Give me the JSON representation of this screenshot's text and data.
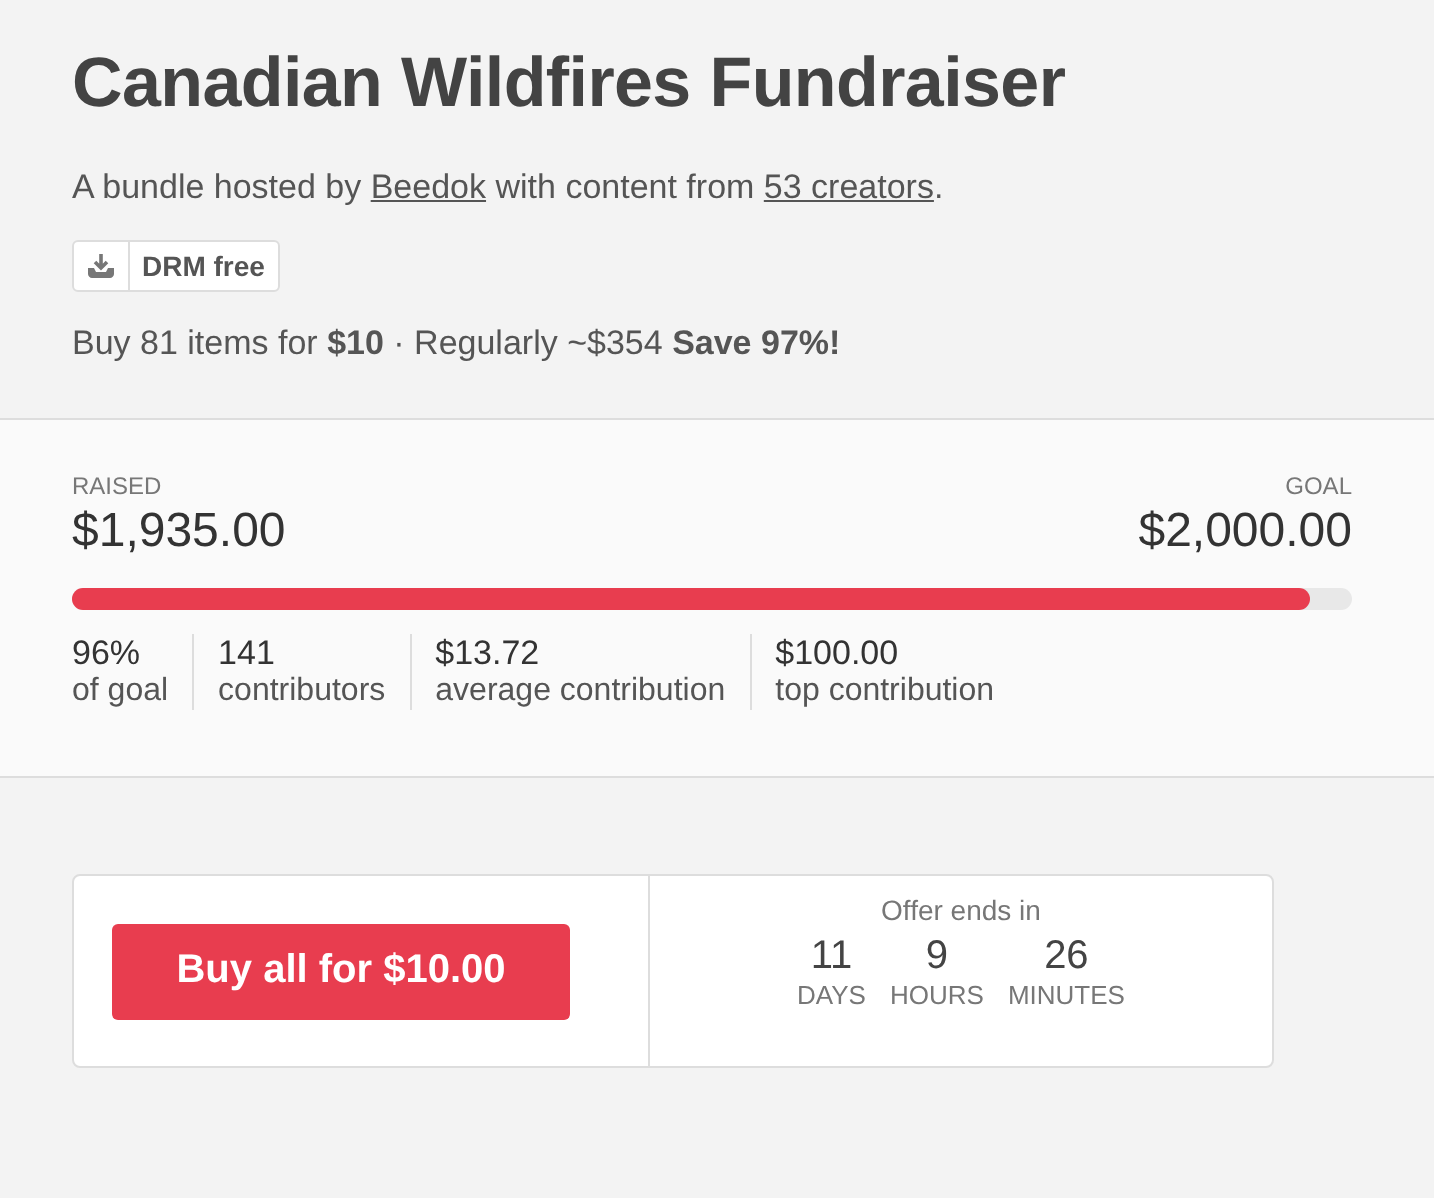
{
  "title": "Canadian Wildfires Fundraiser",
  "subtitle": {
    "before": "A bundle hosted by ",
    "host": "Beedok",
    "middle": " with content from ",
    "creators": "53 creators",
    "after": "."
  },
  "badge": {
    "label": "DRM free"
  },
  "price_line": "Buy 81 items for **$10** · Regularly ~$354 **Save 97%!**",
  "progress": {
    "raised_label": "RAISED",
    "raised": "$1,935.00",
    "goal_label": "GOAL",
    "goal": "$2,000.00",
    "level": 0.967
  },
  "stats": [
    {
      "value": "96%",
      "label": "of goal"
    },
    {
      "value": "141",
      "label": "contributors"
    },
    {
      "value": "$13.72",
      "label": "average contribution"
    },
    {
      "value": "$100.00",
      "label": "top contribution"
    }
  ],
  "purchase": {
    "button": "Buy all for $10.00",
    "offer_label": "Offer ends in",
    "countdown": [
      {
        "value": "11",
        "unit": "DAYS"
      },
      {
        "value": "9",
        "unit": "HOURS"
      },
      {
        "value": "26",
        "unit": "MINUTES"
      }
    ]
  }
}
